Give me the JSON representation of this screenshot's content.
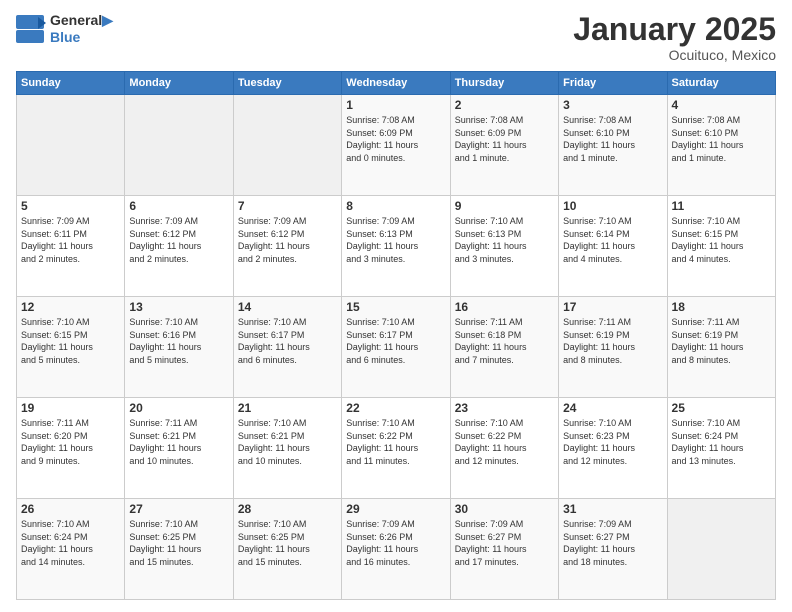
{
  "header": {
    "logo_line1": "General",
    "logo_line2": "Blue",
    "month": "January 2025",
    "location": "Ocuituco, Mexico"
  },
  "days_of_week": [
    "Sunday",
    "Monday",
    "Tuesday",
    "Wednesday",
    "Thursday",
    "Friday",
    "Saturday"
  ],
  "weeks": [
    [
      {
        "day": "",
        "info": ""
      },
      {
        "day": "",
        "info": ""
      },
      {
        "day": "",
        "info": ""
      },
      {
        "day": "1",
        "info": "Sunrise: 7:08 AM\nSunset: 6:09 PM\nDaylight: 11 hours\nand 0 minutes."
      },
      {
        "day": "2",
        "info": "Sunrise: 7:08 AM\nSunset: 6:09 PM\nDaylight: 11 hours\nand 1 minute."
      },
      {
        "day": "3",
        "info": "Sunrise: 7:08 AM\nSunset: 6:10 PM\nDaylight: 11 hours\nand 1 minute."
      },
      {
        "day": "4",
        "info": "Sunrise: 7:08 AM\nSunset: 6:10 PM\nDaylight: 11 hours\nand 1 minute."
      }
    ],
    [
      {
        "day": "5",
        "info": "Sunrise: 7:09 AM\nSunset: 6:11 PM\nDaylight: 11 hours\nand 2 minutes."
      },
      {
        "day": "6",
        "info": "Sunrise: 7:09 AM\nSunset: 6:12 PM\nDaylight: 11 hours\nand 2 minutes."
      },
      {
        "day": "7",
        "info": "Sunrise: 7:09 AM\nSunset: 6:12 PM\nDaylight: 11 hours\nand 2 minutes."
      },
      {
        "day": "8",
        "info": "Sunrise: 7:09 AM\nSunset: 6:13 PM\nDaylight: 11 hours\nand 3 minutes."
      },
      {
        "day": "9",
        "info": "Sunrise: 7:10 AM\nSunset: 6:13 PM\nDaylight: 11 hours\nand 3 minutes."
      },
      {
        "day": "10",
        "info": "Sunrise: 7:10 AM\nSunset: 6:14 PM\nDaylight: 11 hours\nand 4 minutes."
      },
      {
        "day": "11",
        "info": "Sunrise: 7:10 AM\nSunset: 6:15 PM\nDaylight: 11 hours\nand 4 minutes."
      }
    ],
    [
      {
        "day": "12",
        "info": "Sunrise: 7:10 AM\nSunset: 6:15 PM\nDaylight: 11 hours\nand 5 minutes."
      },
      {
        "day": "13",
        "info": "Sunrise: 7:10 AM\nSunset: 6:16 PM\nDaylight: 11 hours\nand 5 minutes."
      },
      {
        "day": "14",
        "info": "Sunrise: 7:10 AM\nSunset: 6:17 PM\nDaylight: 11 hours\nand 6 minutes."
      },
      {
        "day": "15",
        "info": "Sunrise: 7:10 AM\nSunset: 6:17 PM\nDaylight: 11 hours\nand 6 minutes."
      },
      {
        "day": "16",
        "info": "Sunrise: 7:11 AM\nSunset: 6:18 PM\nDaylight: 11 hours\nand 7 minutes."
      },
      {
        "day": "17",
        "info": "Sunrise: 7:11 AM\nSunset: 6:19 PM\nDaylight: 11 hours\nand 8 minutes."
      },
      {
        "day": "18",
        "info": "Sunrise: 7:11 AM\nSunset: 6:19 PM\nDaylight: 11 hours\nand 8 minutes."
      }
    ],
    [
      {
        "day": "19",
        "info": "Sunrise: 7:11 AM\nSunset: 6:20 PM\nDaylight: 11 hours\nand 9 minutes."
      },
      {
        "day": "20",
        "info": "Sunrise: 7:11 AM\nSunset: 6:21 PM\nDaylight: 11 hours\nand 10 minutes."
      },
      {
        "day": "21",
        "info": "Sunrise: 7:10 AM\nSunset: 6:21 PM\nDaylight: 11 hours\nand 10 minutes."
      },
      {
        "day": "22",
        "info": "Sunrise: 7:10 AM\nSunset: 6:22 PM\nDaylight: 11 hours\nand 11 minutes."
      },
      {
        "day": "23",
        "info": "Sunrise: 7:10 AM\nSunset: 6:22 PM\nDaylight: 11 hours\nand 12 minutes."
      },
      {
        "day": "24",
        "info": "Sunrise: 7:10 AM\nSunset: 6:23 PM\nDaylight: 11 hours\nand 12 minutes."
      },
      {
        "day": "25",
        "info": "Sunrise: 7:10 AM\nSunset: 6:24 PM\nDaylight: 11 hours\nand 13 minutes."
      }
    ],
    [
      {
        "day": "26",
        "info": "Sunrise: 7:10 AM\nSunset: 6:24 PM\nDaylight: 11 hours\nand 14 minutes."
      },
      {
        "day": "27",
        "info": "Sunrise: 7:10 AM\nSunset: 6:25 PM\nDaylight: 11 hours\nand 15 minutes."
      },
      {
        "day": "28",
        "info": "Sunrise: 7:10 AM\nSunset: 6:25 PM\nDaylight: 11 hours\nand 15 minutes."
      },
      {
        "day": "29",
        "info": "Sunrise: 7:09 AM\nSunset: 6:26 PM\nDaylight: 11 hours\nand 16 minutes."
      },
      {
        "day": "30",
        "info": "Sunrise: 7:09 AM\nSunset: 6:27 PM\nDaylight: 11 hours\nand 17 minutes."
      },
      {
        "day": "31",
        "info": "Sunrise: 7:09 AM\nSunset: 6:27 PM\nDaylight: 11 hours\nand 18 minutes."
      },
      {
        "day": "",
        "info": ""
      }
    ]
  ]
}
